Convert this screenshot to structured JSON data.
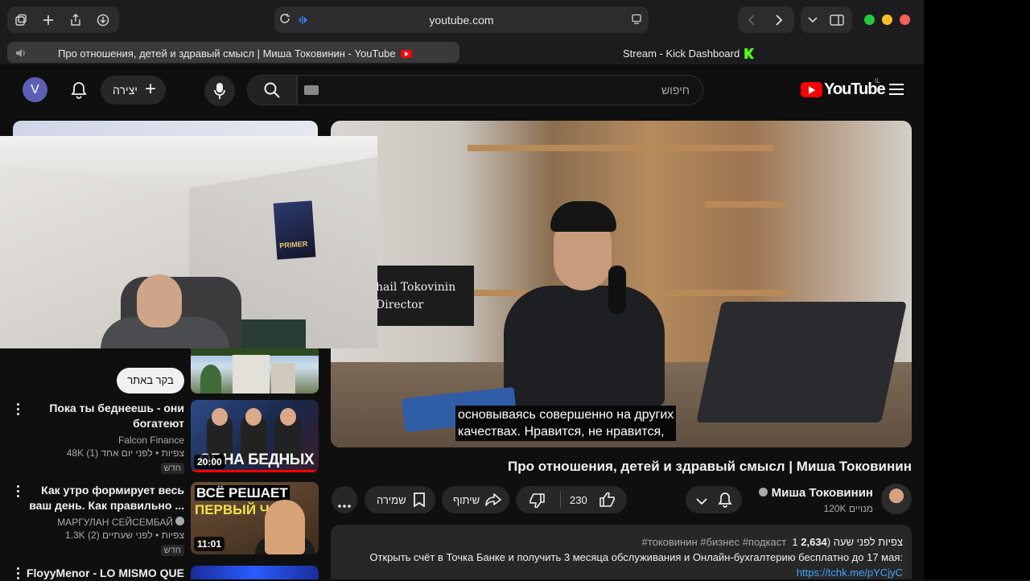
{
  "browser": {
    "url": "youtube.com",
    "tabs": [
      {
        "title": "Про отношения, детей и здравый смысл | Миша Токовинин - YouTube",
        "active": true
      },
      {
        "title": "Stream - Kick Dashboard",
        "active": false
      }
    ],
    "traffic_colors": [
      "#28c840",
      "#febc2e",
      "#ff5f57"
    ]
  },
  "header": {
    "avatar_letter": "V",
    "create_label": "יצירה",
    "search_placeholder": "חיפוש",
    "logo_text": "YouTube",
    "logo_country": "IL"
  },
  "video": {
    "sign_line1": "hail Tokovinin",
    "sign_line2": "Director",
    "subtitle_line1": "основываясь совершенно на других",
    "subtitle_line2": "качествах. Нравится, не нравится,"
  },
  "webcam": {
    "poster_text": "PRIMER"
  },
  "sidebar": {
    "watch_later_label": "בקר באתר",
    "items": [
      {
        "title": "Пока ты беднеешь - они богатеют",
        "channel": "Falcon Finance",
        "stats": "48K צפיות • לפני יום אחד (1)",
        "badge": "חדש",
        "duration": "20:00",
        "thumb_caption": "ОГ НА БЕДНЫХ"
      },
      {
        "title": "Как утро формирует весь ваш день.  Как правильно ...",
        "channel": "МАРГУЛАН СЕЙСЕМБАЙ",
        "stats": "1.3K צפיות • לפני שעתיים (2)",
        "badge": "חדש",
        "duration": "11:01",
        "thumb_caption1": "ВСЁ РЕШАЕТ",
        "thumb_caption2": "ПЕРВЫЙ ЧАС"
      },
      {
        "title": "FloyyMenor - LO MISMO QUE"
      }
    ]
  },
  "info": {
    "title": "Про отношения, детей и здравый смысл | Миша Токовинин",
    "channel_name": "Миша Токовинин",
    "subscribers": "120K מנויים",
    "likes": "230",
    "share_label": "שיתוף",
    "save_label": "שמירה",
    "views": "2,634",
    "views_suffix": "צפיות  לפני שעה (1",
    "hashtags": "#токовинин #бизнес #подкаст",
    "desc_line": "Открыть счёт в Точка Банке и получить 3 месяца обслуживания и Онлайн-бухгалтерию бесплатно до 17 мая:",
    "desc_link": "https://tchk.me/pYCjyC"
  }
}
